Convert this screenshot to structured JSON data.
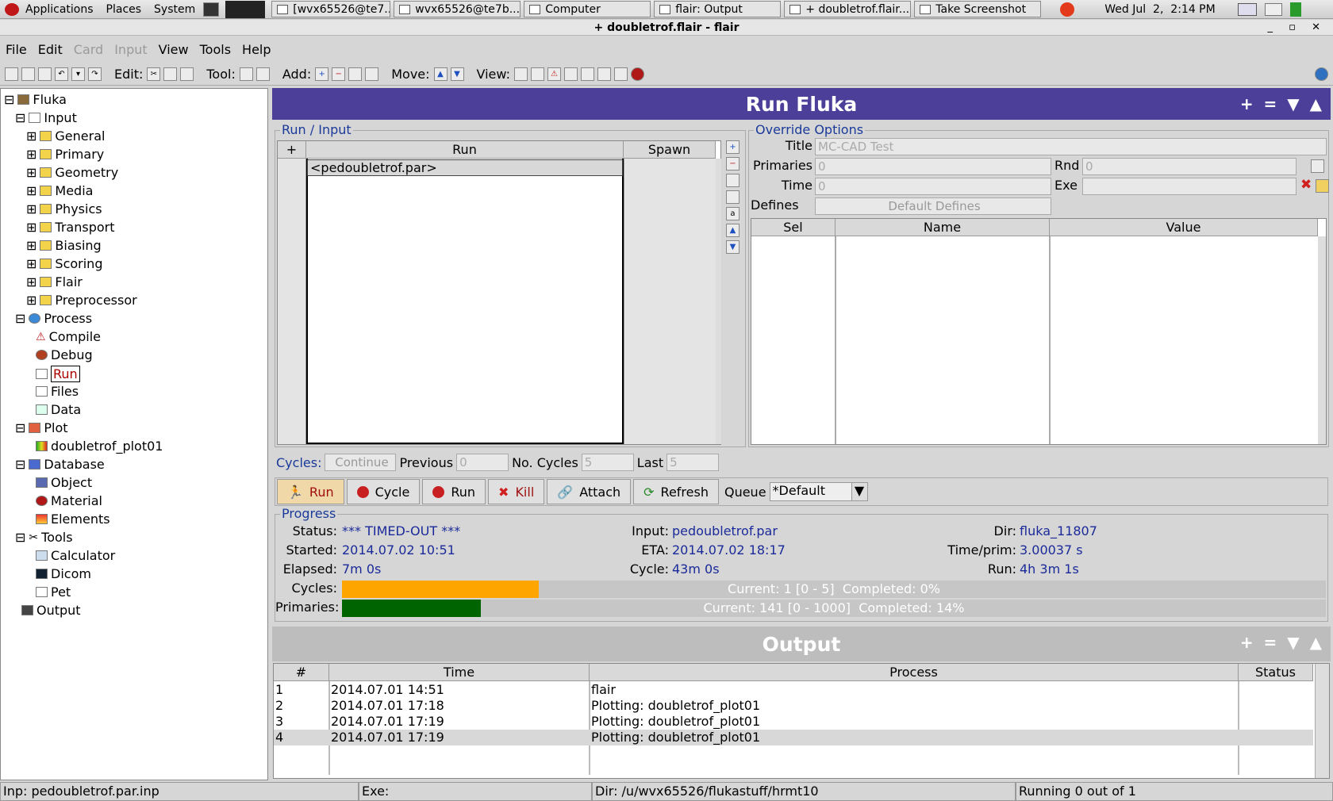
{
  "topbar": {
    "menus": [
      "Applications",
      "Places",
      "System"
    ],
    "tasks": [
      "[wvx65526@te7...",
      "wvx65526@te7b...",
      "Computer",
      "flair: Output",
      "+ doubletrof.flair...",
      "Take Screenshot"
    ],
    "clock": "Wed Jul  2,  2:14 PM"
  },
  "window": {
    "title": "+ doubletrof.flair - flair"
  },
  "menubar": [
    "File",
    "Edit",
    "Card",
    "Input",
    "View",
    "Tools",
    "Help"
  ],
  "toolbar": {
    "edit": "Edit:",
    "tool": "Tool:",
    "add": "Add:",
    "move": "Move:",
    "view": "View:"
  },
  "tree": {
    "root": "Fluka",
    "input": "Input",
    "input_children": [
      "General",
      "Primary",
      "Geometry",
      "Media",
      "Physics",
      "Transport",
      "Biasing",
      "Scoring",
      "Flair",
      "Preprocessor"
    ],
    "process": "Process",
    "process_children": [
      "Compile",
      "Debug",
      "Run",
      "Files",
      "Data"
    ],
    "plot": "Plot",
    "plot_children": [
      "doubletrof_plot01"
    ],
    "database": "Database",
    "database_children": [
      "Object",
      "Material",
      "Elements"
    ],
    "tools": "Tools",
    "tools_children": [
      "Calculator",
      "Dicom",
      "Pet"
    ],
    "output": "Output"
  },
  "run_panel": {
    "header": "Run Fluka",
    "header_controls": "+ = ▼ ▲",
    "run_input": {
      "label": "Run / Input",
      "add": "+",
      "col_run": "Run",
      "col_spawn": "Spawn",
      "rows": [
        "<pedoubletrof.par>"
      ]
    },
    "override": {
      "label": "Override Options",
      "title_label": "Title",
      "title_value": "MC-CAD Test",
      "primaries_label": "Primaries",
      "primaries_value": "0",
      "rnd_label": "Rnd",
      "rnd_value": "0",
      "time_label": "Time",
      "time_value": "0",
      "exe_label": "Exe",
      "defines_label": "Defines",
      "defines_btn": "Default Defines",
      "cols": [
        "Sel",
        "Name",
        "Value"
      ]
    },
    "cycles": {
      "label": "Cycles:",
      "continue": "Continue",
      "previous_label": "Previous",
      "previous": "0",
      "no_cycles_label": "No. Cycles",
      "no_cycles": "5",
      "last_label": "Last",
      "last": "5"
    },
    "buttons": {
      "run1": "Run",
      "cycle": "Cycle",
      "run2": "Run",
      "kill": "Kill",
      "attach": "Attach",
      "refresh": "Refresh"
    },
    "queue_label": "Queue",
    "queue_value": "*Default",
    "progress": {
      "label": "Progress",
      "status_label": "Status:",
      "status": "*** TIMED-OUT ***",
      "input_label": "Input:",
      "input": "pedoubletrof.par",
      "dir_label": "Dir:",
      "dir": "fluka_11807",
      "started_label": "Started:",
      "started": "2014.07.02 10:51",
      "eta_label": "ETA:",
      "eta": "2014.07.02 18:17",
      "timeprim_label": "Time/prim:",
      "timeprim": "3.00037 s",
      "elapsed_label": "Elapsed:",
      "elapsed": "7m 0s",
      "cycle_label": "Cycle:",
      "cycle": "43m 0s",
      "run_label": "Run:",
      "run": "4h 3m 1s",
      "cycles_bar_label": "Cycles:",
      "cycles_text": "Current: 1 [0 - 5]  Completed: 0%",
      "cycles_fill": 0.2,
      "cycles_color": "#ffa500",
      "primaries_bar_label": "Primaries:",
      "primaries_text": "Current: 141 [0 - 1000]  Completed: 14%",
      "primaries_fill": 0.141,
      "primaries_color": "#006400"
    }
  },
  "output_panel": {
    "header": "Output",
    "header_controls": "+ = ▼ ▲",
    "cols": [
      "#",
      "Time",
      "Process",
      "Status"
    ],
    "rows": [
      {
        "n": "1",
        "time": "2014.07.01 14:51",
        "process": "flair",
        "status": ""
      },
      {
        "n": "2",
        "time": "2014.07.01 17:18",
        "process": "Plotting: doubletrof_plot01",
        "status": ""
      },
      {
        "n": "3",
        "time": "2014.07.01 17:19",
        "process": "Plotting: doubletrof_plot01",
        "status": ""
      },
      {
        "n": "4",
        "time": "2014.07.01 17:19",
        "process": "Plotting: doubletrof_plot01",
        "status": ""
      }
    ]
  },
  "statusbar": {
    "inp": "Inp: pedoubletrof.par.inp",
    "exe": "Exe:",
    "dir": "Dir: /u/wvx65526/flukastuff/hrmt10",
    "running": "Running 0 out of 1"
  },
  "colors": {
    "run_header": "#4b3f9a",
    "output_header": "#bdbdbd",
    "value_text": "#1a2a9a"
  }
}
